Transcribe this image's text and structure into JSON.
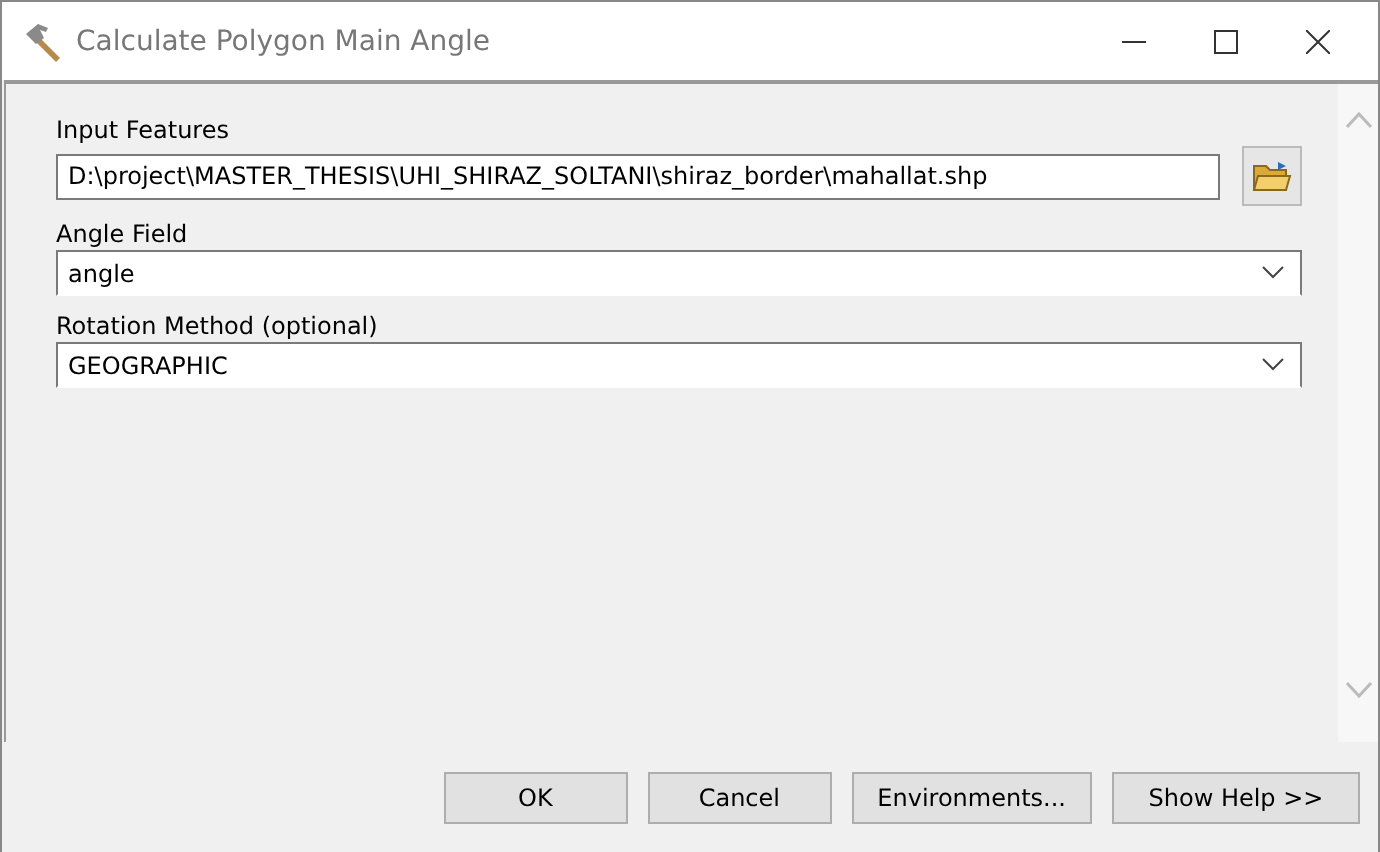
{
  "window": {
    "title": "Calculate Polygon Main Angle"
  },
  "fields": [
    {
      "kind": "path",
      "label": "Input Features",
      "value": "D:\\project\\MASTER_THESIS\\UHI_SHIRAZ_SOLTANI\\shiraz_border\\mahallat.shp"
    },
    {
      "kind": "dropdown",
      "label": "Angle Field",
      "value": "angle"
    },
    {
      "kind": "dropdown",
      "label": "Rotation Method (optional)",
      "value": "GEOGRAPHIC"
    }
  ],
  "buttons": [
    "OK",
    "Cancel",
    "Environments...",
    "Show Help >>"
  ]
}
